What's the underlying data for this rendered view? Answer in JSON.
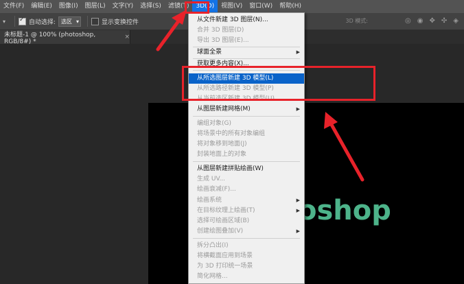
{
  "menubar": {
    "items": [
      "文件(F)",
      "编辑(E)",
      "图像(I)",
      "图层(L)",
      "文字(Y)",
      "选择(S)",
      "滤镜(T)",
      "3D(D)",
      "视图(V)",
      "窗口(W)",
      "帮助(H)"
    ]
  },
  "options": {
    "auto_select_label": "自动选择:",
    "auto_select_value": "选区",
    "transform_label": "显示变换控件",
    "mode_label": "3D 模式:"
  },
  "document_tab": {
    "title": "未标题-1 @ 100% (photoshop, RGB/8#) *",
    "close": "×"
  },
  "canvas": {
    "text": "oshop"
  },
  "menu3d": {
    "items": [
      {
        "label": "从文件新建 3D 图层(N)...",
        "disabled": false
      },
      {
        "label": "合并 3D 图层(D)",
        "disabled": true
      },
      {
        "label": "导出 3D 图层(E)...",
        "disabled": true
      },
      {
        "label": "球面全景",
        "disabled": false,
        "sub": true
      },
      {
        "label": "获取更多内容(X)...",
        "disabled": false
      },
      {
        "label": "从所选图层新建 3D 模型(L)",
        "disabled": false,
        "highlight": true
      },
      {
        "label": "从所选路径新建 3D 模型(P)",
        "disabled": true
      },
      {
        "label": "从当前选区新建 3D 模型(U)",
        "disabled": true
      },
      {
        "label": "从图层新建网格(M)",
        "disabled": false,
        "sub": true
      },
      {
        "label": "编组对象(G)",
        "disabled": true
      },
      {
        "label": "将场景中的所有对象编组",
        "disabled": true
      },
      {
        "label": "将对象移到地面(J)",
        "disabled": true
      },
      {
        "label": "封装地面上的对象",
        "disabled": true
      },
      {
        "label": "从图层新建拼贴绘画(W)",
        "disabled": false
      },
      {
        "label": "生成 UV...",
        "disabled": true
      },
      {
        "label": "绘画衰减(F)...",
        "disabled": true
      },
      {
        "label": "绘画系统",
        "disabled": true,
        "sub": true
      },
      {
        "label": "在目标纹理上绘画(T)",
        "disabled": true,
        "sub": true
      },
      {
        "label": "选择可绘画区域(B)",
        "disabled": true
      },
      {
        "label": "创建绘图叠加(V)",
        "disabled": true,
        "sub": true
      },
      {
        "label": "拆分凸出(I)",
        "disabled": true
      },
      {
        "label": "将横截面应用到场景",
        "disabled": true
      },
      {
        "label": "为 3D 打印统一场景",
        "disabled": true
      },
      {
        "label": "简化网格...",
        "disabled": true
      }
    ],
    "submenu_arrow": "▶"
  },
  "colors": {
    "highlight": "#0a63c9",
    "annotation_red": "#e8222a",
    "canvas_text": "#4db38a"
  }
}
